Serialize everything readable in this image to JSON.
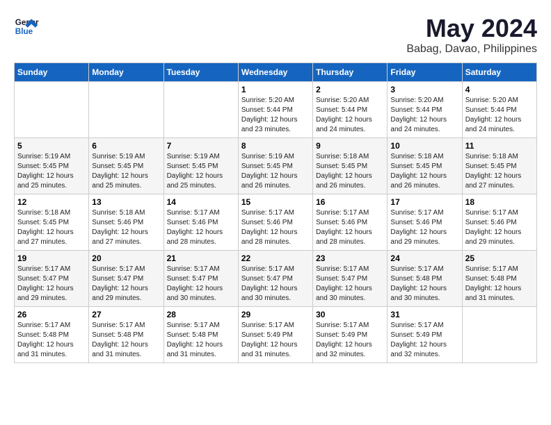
{
  "header": {
    "logo_line1": "General",
    "logo_line2": "Blue",
    "main_title": "May 2024",
    "subtitle": "Babag, Davao, Philippines"
  },
  "calendar": {
    "days_of_week": [
      "Sunday",
      "Monday",
      "Tuesday",
      "Wednesday",
      "Thursday",
      "Friday",
      "Saturday"
    ],
    "weeks": [
      [
        {
          "day": "",
          "info": ""
        },
        {
          "day": "",
          "info": ""
        },
        {
          "day": "",
          "info": ""
        },
        {
          "day": "1",
          "info": "Sunrise: 5:20 AM\nSunset: 5:44 PM\nDaylight: 12 hours\nand 23 minutes."
        },
        {
          "day": "2",
          "info": "Sunrise: 5:20 AM\nSunset: 5:44 PM\nDaylight: 12 hours\nand 24 minutes."
        },
        {
          "day": "3",
          "info": "Sunrise: 5:20 AM\nSunset: 5:44 PM\nDaylight: 12 hours\nand 24 minutes."
        },
        {
          "day": "4",
          "info": "Sunrise: 5:20 AM\nSunset: 5:44 PM\nDaylight: 12 hours\nand 24 minutes."
        }
      ],
      [
        {
          "day": "5",
          "info": "Sunrise: 5:19 AM\nSunset: 5:45 PM\nDaylight: 12 hours\nand 25 minutes."
        },
        {
          "day": "6",
          "info": "Sunrise: 5:19 AM\nSunset: 5:45 PM\nDaylight: 12 hours\nand 25 minutes."
        },
        {
          "day": "7",
          "info": "Sunrise: 5:19 AM\nSunset: 5:45 PM\nDaylight: 12 hours\nand 25 minutes."
        },
        {
          "day": "8",
          "info": "Sunrise: 5:19 AM\nSunset: 5:45 PM\nDaylight: 12 hours\nand 26 minutes."
        },
        {
          "day": "9",
          "info": "Sunrise: 5:18 AM\nSunset: 5:45 PM\nDaylight: 12 hours\nand 26 minutes."
        },
        {
          "day": "10",
          "info": "Sunrise: 5:18 AM\nSunset: 5:45 PM\nDaylight: 12 hours\nand 26 minutes."
        },
        {
          "day": "11",
          "info": "Sunrise: 5:18 AM\nSunset: 5:45 PM\nDaylight: 12 hours\nand 27 minutes."
        }
      ],
      [
        {
          "day": "12",
          "info": "Sunrise: 5:18 AM\nSunset: 5:45 PM\nDaylight: 12 hours\nand 27 minutes."
        },
        {
          "day": "13",
          "info": "Sunrise: 5:18 AM\nSunset: 5:46 PM\nDaylight: 12 hours\nand 27 minutes."
        },
        {
          "day": "14",
          "info": "Sunrise: 5:17 AM\nSunset: 5:46 PM\nDaylight: 12 hours\nand 28 minutes."
        },
        {
          "day": "15",
          "info": "Sunrise: 5:17 AM\nSunset: 5:46 PM\nDaylight: 12 hours\nand 28 minutes."
        },
        {
          "day": "16",
          "info": "Sunrise: 5:17 AM\nSunset: 5:46 PM\nDaylight: 12 hours\nand 28 minutes."
        },
        {
          "day": "17",
          "info": "Sunrise: 5:17 AM\nSunset: 5:46 PM\nDaylight: 12 hours\nand 29 minutes."
        },
        {
          "day": "18",
          "info": "Sunrise: 5:17 AM\nSunset: 5:46 PM\nDaylight: 12 hours\nand 29 minutes."
        }
      ],
      [
        {
          "day": "19",
          "info": "Sunrise: 5:17 AM\nSunset: 5:47 PM\nDaylight: 12 hours\nand 29 minutes."
        },
        {
          "day": "20",
          "info": "Sunrise: 5:17 AM\nSunset: 5:47 PM\nDaylight: 12 hours\nand 29 minutes."
        },
        {
          "day": "21",
          "info": "Sunrise: 5:17 AM\nSunset: 5:47 PM\nDaylight: 12 hours\nand 30 minutes."
        },
        {
          "day": "22",
          "info": "Sunrise: 5:17 AM\nSunset: 5:47 PM\nDaylight: 12 hours\nand 30 minutes."
        },
        {
          "day": "23",
          "info": "Sunrise: 5:17 AM\nSunset: 5:47 PM\nDaylight: 12 hours\nand 30 minutes."
        },
        {
          "day": "24",
          "info": "Sunrise: 5:17 AM\nSunset: 5:48 PM\nDaylight: 12 hours\nand 30 minutes."
        },
        {
          "day": "25",
          "info": "Sunrise: 5:17 AM\nSunset: 5:48 PM\nDaylight: 12 hours\nand 31 minutes."
        }
      ],
      [
        {
          "day": "26",
          "info": "Sunrise: 5:17 AM\nSunset: 5:48 PM\nDaylight: 12 hours\nand 31 minutes."
        },
        {
          "day": "27",
          "info": "Sunrise: 5:17 AM\nSunset: 5:48 PM\nDaylight: 12 hours\nand 31 minutes."
        },
        {
          "day": "28",
          "info": "Sunrise: 5:17 AM\nSunset: 5:48 PM\nDaylight: 12 hours\nand 31 minutes."
        },
        {
          "day": "29",
          "info": "Sunrise: 5:17 AM\nSunset: 5:49 PM\nDaylight: 12 hours\nand 31 minutes."
        },
        {
          "day": "30",
          "info": "Sunrise: 5:17 AM\nSunset: 5:49 PM\nDaylight: 12 hours\nand 32 minutes."
        },
        {
          "day": "31",
          "info": "Sunrise: 5:17 AM\nSunset: 5:49 PM\nDaylight: 12 hours\nand 32 minutes."
        },
        {
          "day": "",
          "info": ""
        }
      ]
    ]
  }
}
